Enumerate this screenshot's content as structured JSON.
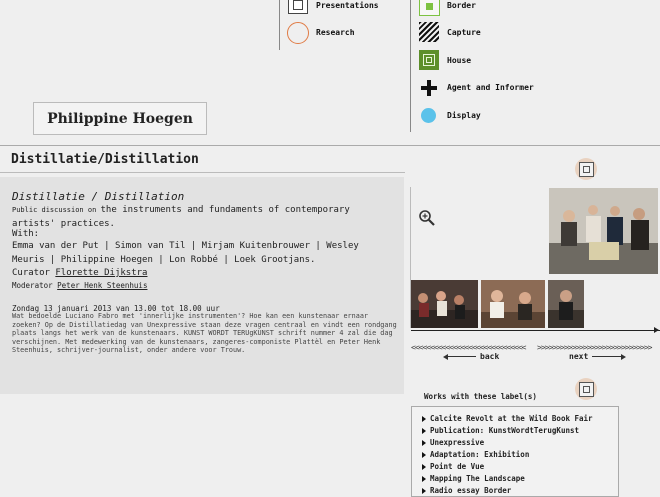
{
  "legend": {
    "presentations": "Presentations",
    "research": "Research",
    "border": "Border",
    "capture": "Capture",
    "house": "House",
    "agent": "Agent and Informer",
    "display": "Display"
  },
  "artist_name": "Philippine Hoegen",
  "page_title": "Distillatie/Distillation",
  "sub_title": "Distillatie / Distillation",
  "intro_prefix": "Public discussion on ",
  "intro_main": "the instruments and fundaments of contemporary artists' practices.",
  "with_label": "With:",
  "participants": "Emma van der Put | Simon van Til | Mirjam Kuitenbrouwer | Wesley Meuris | Philippine Hoegen | Lon Robbé | Loek Grootjans.",
  "curator_label": "Curator ",
  "curator_name": "Florette Dijkstra",
  "moderator_label": "Moderator ",
  "moderator_name": "Peter Henk Steenhuis",
  "date_line": "Zondag 13 januari 2013 van 13.00 tot 18.00 uur",
  "description": "Wat bedoelde Luciano Fabro met 'innerlijke instrumenten'? Hoe kan een kunstenaar ernaar zoeken? Op de Distillatiedag van Unexpressive staan deze vragen centraal en vindt een rondgang plaats langs het werk van de kunstenaars. KUNST WORDT TERUgKUNST schrift nummer 4 zal die dag verschijnen. Met medewerking van de kunstenaars, zangeres-componiste Plattèl en Peter Henk Steenhuis, schrijver-journalist, onder andere voor Trouw.",
  "nav": {
    "back": "back",
    "next": "next"
  },
  "works_heading": "Works with these label(s)",
  "works": [
    "Calcite Revolt at the Wild Book Fair",
    "Publication: KunstWordtTerugKunst",
    "Unexpressive",
    "Adaptation: Exhibition",
    "Point de Vue",
    "Mapping The Landscape",
    "Radio essay Border"
  ],
  "colors": {
    "border_green": "#7dc242",
    "house_green": "#5d8f2a",
    "research_orange": "#e07b45",
    "display_blue": "#5bc2ea",
    "presentations_brown": "#a07a5a"
  },
  "icons": {
    "zoom": "zoom-in-icon",
    "label": "presentations-icon"
  }
}
